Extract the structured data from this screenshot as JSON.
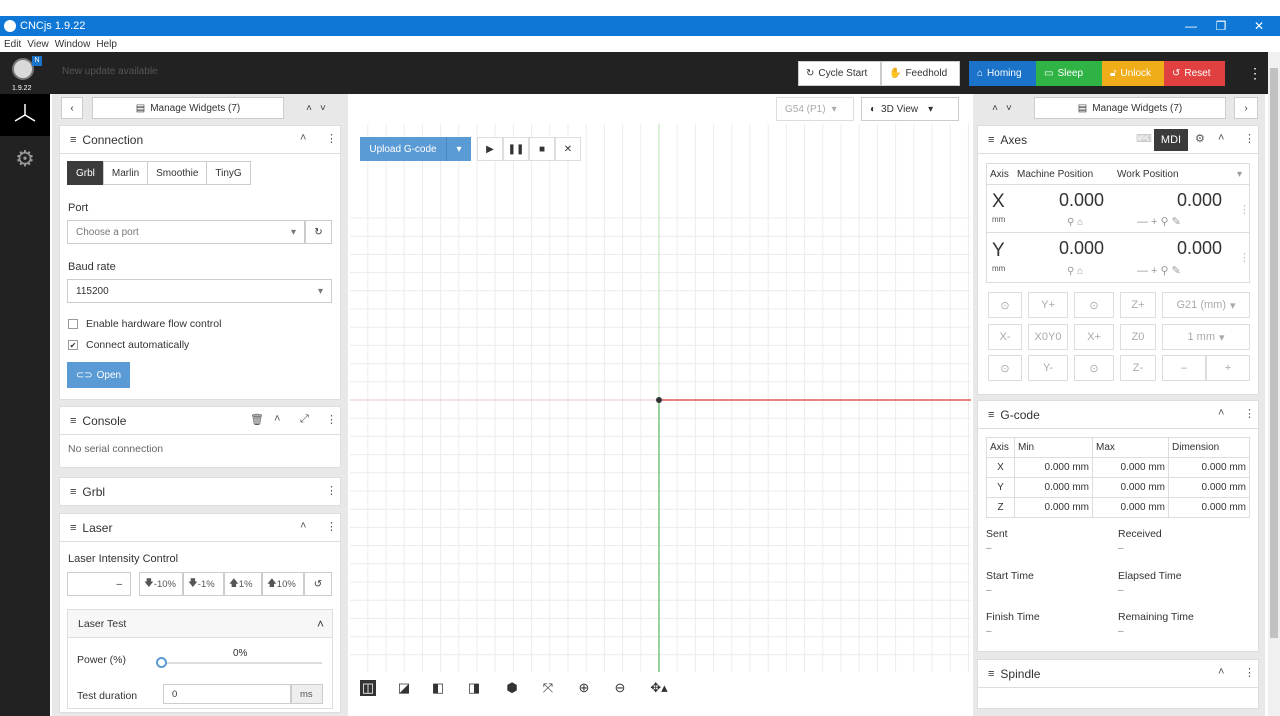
{
  "window": {
    "title": "CNCjs 1.9.22",
    "minimize": "—",
    "restore": "❐",
    "close": "✕"
  },
  "menu": [
    "Edit",
    "View",
    "Window",
    "Help"
  ],
  "appbar": {
    "version": "1.9.22",
    "badge": "N",
    "update_note": "New update available",
    "cycle_start": "Cycle Start",
    "feedhold": "Feedhold",
    "homing": "Homing",
    "sleep": "Sleep",
    "unlock": "Unlock",
    "reset": "Reset",
    "more": "⋮",
    "colors": {
      "homing": "#1a73c9",
      "sleep": "#2fb344",
      "unlock": "#f0ad1a",
      "reset": "#e04040"
    }
  },
  "left": {
    "prev": "‹",
    "manage": "Manage Widgets (7)",
    "up": "˄",
    "down": "˅",
    "connection": {
      "title": "Connection",
      "tabs": [
        "Grbl",
        "Marlin",
        "Smoothie",
        "TinyG"
      ],
      "port_label": "Port",
      "port_placeholder": "Choose a port",
      "baud_label": "Baud rate",
      "baud_value": "115200",
      "hw_flow": "Enable hardware flow control",
      "auto_connect": "Connect automatically",
      "open": "Open"
    },
    "console": {
      "title": "Console",
      "status": "No serial connection"
    },
    "grbl": {
      "title": "Grbl"
    },
    "laser": {
      "title": "Laser",
      "intensity_label": "Laser Intensity Control",
      "intensity_value": "–",
      "btns": [
        "-10%",
        "-1%",
        "1%",
        "10%"
      ],
      "test_label": "Laser Test",
      "power_label": "Power (%)",
      "power_value": "0%",
      "duration_label": "Test duration",
      "duration_value": "0",
      "duration_unit": "ms"
    }
  },
  "center": {
    "wcs": "G54 (P1)",
    "view3d": "3D View",
    "upload": "Upload G-code"
  },
  "right": {
    "manage": "Manage Widgets (7)",
    "next": "›",
    "axes": {
      "title": "Axes",
      "mdi": "MDI",
      "col_axis": "Axis",
      "col_machine": "Machine Position",
      "col_work": "Work Position",
      "rows": [
        {
          "axis": "X",
          "unit": "mm",
          "machine": "0.000",
          "work": "0.000"
        },
        {
          "axis": "Y",
          "unit": "mm",
          "machine": "0.000",
          "work": "0.000"
        }
      ],
      "jog": [
        [
          "",
          "Y+",
          "",
          "Z+",
          "G21 (mm)"
        ],
        [
          "X-",
          "X0Y0",
          "X+",
          "Z0",
          "1 mm"
        ],
        [
          "",
          "Y-",
          "",
          "Z-",
          "–",
          "+"
        ]
      ]
    },
    "gcode": {
      "title": "G-code",
      "headers": [
        "Axis",
        "Min",
        "Max",
        "Dimension"
      ],
      "rows": [
        [
          "X",
          "0.000 mm",
          "0.000 mm",
          "0.000 mm"
        ],
        [
          "Y",
          "0.000 mm",
          "0.000 mm",
          "0.000 mm"
        ],
        [
          "Z",
          "0.000 mm",
          "0.000 mm",
          "0.000 mm"
        ]
      ],
      "sent": "Sent",
      "received": "Received",
      "start_time": "Start Time",
      "elapsed_time": "Elapsed Time",
      "finish_time": "Finish Time",
      "remaining_time": "Remaining Time",
      "dash": "–"
    },
    "spindle": {
      "title": "Spindle"
    }
  }
}
